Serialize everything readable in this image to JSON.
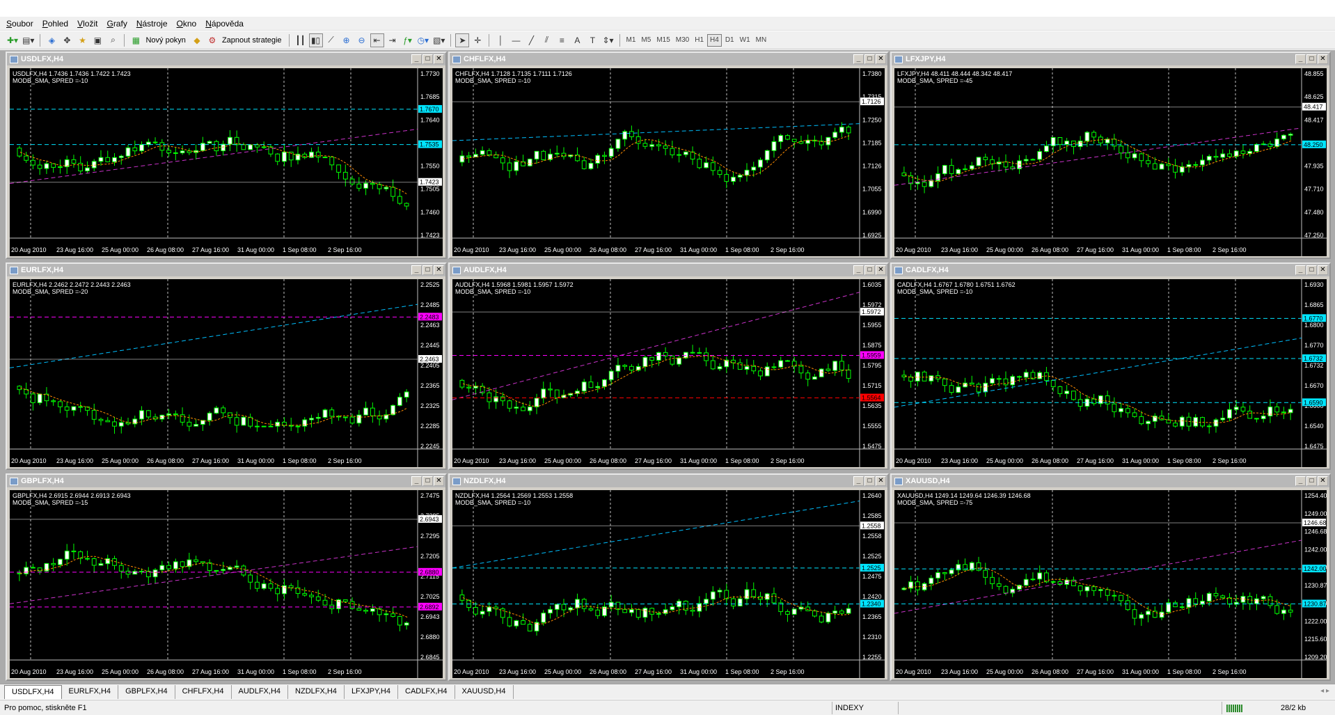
{
  "menu": [
    "Soubor",
    "Pohled",
    "Vložit",
    "Grafy",
    "Nástroje",
    "Okno",
    "Nápověda"
  ],
  "toolbar": {
    "new_order_label": "Nový pokyn",
    "strategy_label": "Zapnout strategie",
    "timeframes": [
      "M1",
      "M5",
      "M15",
      "M30",
      "H1",
      "H4",
      "D1",
      "W1",
      "MN"
    ],
    "active_timeframe": "H4"
  },
  "x_labels": [
    "20 Aug 2010",
    "23 Aug 16:00",
    "25 Aug 00:00",
    "26 Aug 08:00",
    "27 Aug 16:00",
    "31 Aug 00:00",
    "1 Sep 08:00",
    "2 Sep 16:00"
  ],
  "charts": [
    {
      "title": "USDLFX,H4",
      "info": "USDLFX,H4  1.7436 1.7436 1.7422 1.7423",
      "spread": "MODB_SMA, SPRED =-10",
      "y_labels": [
        "1.7730",
        "1.7685",
        "1.7640",
        "1.7595",
        "1.7550",
        "1.7505",
        "1.7460",
        "1.7423"
      ],
      "price_tags": [
        {
          "text": "1.7670",
          "color": "#00e5ff"
        },
        {
          "text": "1.7535",
          "color": "#00e5ff"
        },
        {
          "text": "1.7423",
          "color": "#ffffff"
        }
      ]
    },
    {
      "title": "CHFLFX,H4",
      "info": "CHFLFX,H4  1.7128 1.7135 1.7111 1.7126",
      "spread": "MODB_SMA, SPRED =-10",
      "y_labels": [
        "1.7380",
        "1.7315",
        "1.7250",
        "1.7185",
        "1.7126",
        "1.7055",
        "1.6990",
        "1.6925"
      ],
      "price_tags": [
        {
          "text": "1.7126",
          "color": "#ffffff"
        }
      ]
    },
    {
      "title": "LFXJPY,H4",
      "info": "LFXJPY,H4  48.411 48.444 48.342 48.417",
      "spread": "MODB_SMA, SPRED =-45",
      "y_labels": [
        "48.855",
        "48.625",
        "48.417",
        "48.165",
        "47.935",
        "47.710",
        "47.480",
        "47.250"
      ],
      "price_tags": [
        {
          "text": "48.417",
          "color": "#ffffff"
        },
        {
          "text": "48.250",
          "color": "#00e5ff"
        }
      ]
    },
    {
      "title": "EURLFX,H4",
      "info": "EURLFX,H4  2.2462 2.2472 2.2443 2.2463",
      "spread": "MODB_SMA, SPRED =-20",
      "y_labels": [
        "2.2525",
        "2.2485",
        "2.2463",
        "2.2445",
        "2.2405",
        "2.2365",
        "2.2325",
        "2.2285",
        "2.2245"
      ],
      "price_tags": [
        {
          "text": "2.2483",
          "color": "#ff00ff"
        },
        {
          "text": "2.2463",
          "color": "#ffffff"
        }
      ]
    },
    {
      "title": "AUDLFX,H4",
      "info": "AUDLFX,H4  1.5968 1.5981 1.5957 1.5972",
      "spread": "MODB_SMA, SPRED =-10",
      "y_labels": [
        "1.6035",
        "1.5972",
        "1.5955",
        "1.5875",
        "1.5795",
        "1.5715",
        "1.5635",
        "1.5555",
        "1.5475"
      ],
      "price_tags": [
        {
          "text": "1.5972",
          "color": "#ffffff"
        },
        {
          "text": "1.5959",
          "color": "#ff00ff"
        },
        {
          "text": "1.5564",
          "color": "#ff0000"
        }
      ]
    },
    {
      "title": "CADLFX,H4",
      "info": "CADLFX,H4  1.6767 1.6780 1.6751 1.6762",
      "spread": "MODB_SMA, SPRED =-10",
      "y_labels": [
        "1.6930",
        "1.6865",
        "1.6800",
        "1.6770",
        "1.6732",
        "1.6670",
        "1.6600",
        "1.6540",
        "1.6475"
      ],
      "price_tags": [
        {
          "text": "1.6770",
          "color": "#00e5ff"
        },
        {
          "text": "1.6732",
          "color": "#00e5ff"
        },
        {
          "text": "1.6590",
          "color": "#00e5ff"
        }
      ]
    },
    {
      "title": "GBPLFX,H4",
      "info": "GBPLFX,H4  2.6915 2.6944 2.6913 2.6943",
      "spread": "MODB_SMA, SPRED =-15",
      "y_labels": [
        "2.7475",
        "2.7385",
        "2.7295",
        "2.7205",
        "2.7115",
        "2.7025",
        "2.6943",
        "2.6880",
        "2.6845"
      ],
      "price_tags": [
        {
          "text": "2.6943",
          "color": "#ffffff"
        },
        {
          "text": "2.6880",
          "color": "#ff00ff"
        },
        {
          "text": "2.6892",
          "color": "#ff00ff"
        }
      ]
    },
    {
      "title": "NZDLFX,H4",
      "info": "NZDLFX,H4  1.2564 1.2569 1.2553 1.2558",
      "spread": "MODB_SMA, SPRED =-10",
      "y_labels": [
        "1.2640",
        "1.2585",
        "1.2558",
        "1.2525",
        "1.2475",
        "1.2420",
        "1.2365",
        "1.2310",
        "1.2255"
      ],
      "price_tags": [
        {
          "text": "1.2558",
          "color": "#ffffff"
        },
        {
          "text": "1.2525",
          "color": "#00e5ff"
        },
        {
          "text": "1.2340",
          "color": "#00e5ff"
        }
      ]
    },
    {
      "title": "XAUUSD,H4",
      "info": "XAUUSD,H4  1249.14 1249.64 1246.39 1246.68",
      "spread": "MODB_SMA, SPRED =-75",
      "y_labels": [
        "1254.40",
        "1249.00",
        "1246.68",
        "1242.00",
        "1235.00",
        "1230.87",
        "1228.60",
        "1222.00",
        "1215.60",
        "1209.20"
      ],
      "price_tags": [
        {
          "text": "1246.68",
          "color": "#ffffff"
        },
        {
          "text": "1242.00",
          "color": "#00e5ff"
        },
        {
          "text": "1230.87",
          "color": "#00e5ff"
        }
      ]
    }
  ],
  "tabs": [
    "USDLFX,H4",
    "EURLFX,H4",
    "GBPLFX,H4",
    "CHFLFX,H4",
    "AUDLFX,H4",
    "NZDLFX,H4",
    "LFXJPY,H4",
    "CADLFX,H4",
    "XAUUSD,H4"
  ],
  "active_tab": "USDLFX,H4",
  "status": {
    "help": "Pro pomoc, stiskněte F1",
    "profile": "INDEXY",
    "connection": "28/2 kb"
  },
  "colors": {
    "bull_candle": "#ffffff",
    "candle_outline": "#00ff00",
    "sma": "#ff8c00",
    "grid": "#808080"
  }
}
